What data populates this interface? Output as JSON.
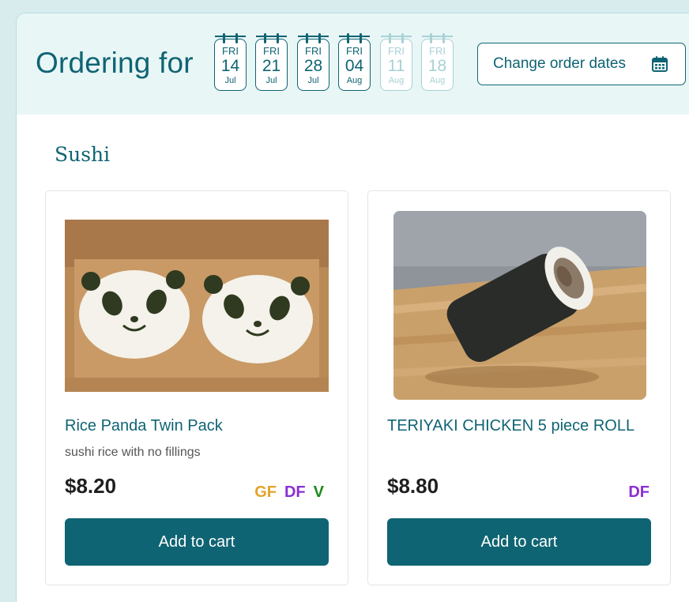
{
  "header": {
    "title": "Ordering for",
    "dates": [
      {
        "dow": "FRI",
        "day": "14",
        "month": "Jul",
        "available": true
      },
      {
        "dow": "FRI",
        "day": "21",
        "month": "Jul",
        "available": true
      },
      {
        "dow": "FRI",
        "day": "28",
        "month": "Jul",
        "available": true
      },
      {
        "dow": "FRI",
        "day": "04",
        "month": "Aug",
        "available": true
      },
      {
        "dow": "FRI",
        "day": "11",
        "month": "Aug",
        "available": false
      },
      {
        "dow": "FRI",
        "day": "18",
        "month": "Aug",
        "available": false
      }
    ],
    "change_button_label": "Change order dates",
    "change_button_icon": "calendar-icon"
  },
  "section": {
    "title": "Sushi"
  },
  "products": [
    {
      "name": "Rice Panda Twin Pack",
      "description": "sushi rice with no fillings",
      "price": "$8.20",
      "tags": [
        "GF",
        "DF",
        "V"
      ],
      "button_label": "Add to cart"
    },
    {
      "name": "TERIYAKI CHICKEN 5 piece ROLL",
      "description": "",
      "price": "$8.80",
      "tags": [
        "DF"
      ],
      "button_label": "Add to cart"
    }
  ],
  "colors": {
    "brand": "#0f6473",
    "header_bg": "#e9f6f6",
    "tag_gf": "#e3a32b",
    "tag_df": "#8a2fd3",
    "tag_v": "#1b8a1b"
  }
}
